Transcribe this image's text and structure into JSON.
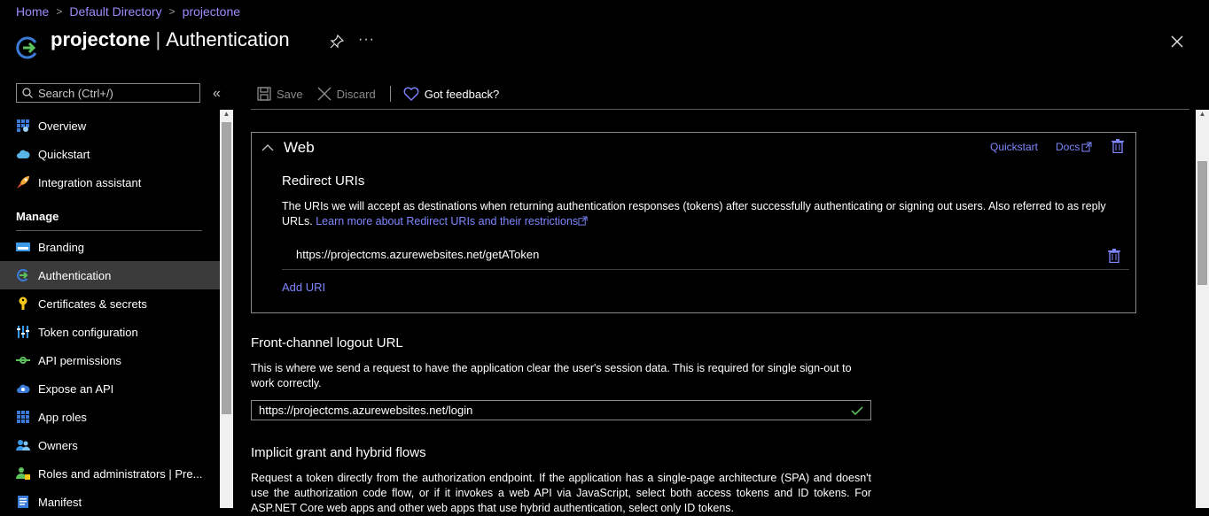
{
  "breadcrumb": {
    "items": [
      "Home",
      "Default Directory",
      "projectone"
    ]
  },
  "header": {
    "app_name": "projectone",
    "separator": "|",
    "page": "Authentication",
    "more": "···"
  },
  "sidebar": {
    "search_placeholder": "Search (Ctrl+/)",
    "collapse": "«",
    "top_items": [
      {
        "label": "Overview",
        "icon": "overview-grid-icon"
      },
      {
        "label": "Quickstart",
        "icon": "cloud-quickstart-icon"
      },
      {
        "label": "Integration assistant",
        "icon": "rocket-icon"
      }
    ],
    "section": "Manage",
    "items": [
      {
        "label": "Branding",
        "icon": "branding-icon"
      },
      {
        "label": "Authentication",
        "icon": "authentication-arrow-icon",
        "active": true
      },
      {
        "label": "Certificates & secrets",
        "icon": "key-icon"
      },
      {
        "label": "Token configuration",
        "icon": "token-bars-icon"
      },
      {
        "label": "API permissions",
        "icon": "api-permissions-icon"
      },
      {
        "label": "Expose an API",
        "icon": "cloud-api-icon"
      },
      {
        "label": "App roles",
        "icon": "app-roles-grid-icon"
      },
      {
        "label": "Owners",
        "icon": "owners-icon"
      },
      {
        "label": "Roles and administrators | Pre...",
        "icon": "roles-admin-icon"
      },
      {
        "label": "Manifest",
        "icon": "manifest-icon"
      }
    ]
  },
  "toolbar": {
    "save_label": "Save",
    "discard_label": "Discard",
    "feedback_label": "Got feedback?"
  },
  "web": {
    "title": "Web",
    "quickstart": "Quickstart",
    "docs": "Docs",
    "redirect_title": "Redirect URIs",
    "redirect_desc": "The URIs we will accept as destinations when returning authentication responses (tokens) after successfully authenticating or signing out users. Also referred to as reply URLs.",
    "redirect_link": "Learn more about Redirect URIs and their restrictions",
    "uris": [
      "https://projectcms.azurewebsites.net/getAToken"
    ],
    "add_uri": "Add URI"
  },
  "front_channel": {
    "title": "Front-channel logout URL",
    "desc": "This is where we send a request to have the application clear the user's session data. This is required for single sign-out to work correctly.",
    "value": "https://projectcms.azurewebsites.net/login"
  },
  "implicit": {
    "title": "Implicit grant and hybrid flows",
    "desc": "Request a token directly from the authorization endpoint. If the application has a single-page architecture (SPA) and doesn't use the authorization code flow, or if it invokes a web API via JavaScript, select both access tokens and ID tokens. For ASP.NET Core web apps and other web apps that use hybrid authentication, select only ID tokens."
  },
  "colors": {
    "accent": "#7f87ff",
    "breadcrumb": "#9e8cff",
    "active_bg": "#3b3b3b",
    "success": "#5cb85c"
  }
}
